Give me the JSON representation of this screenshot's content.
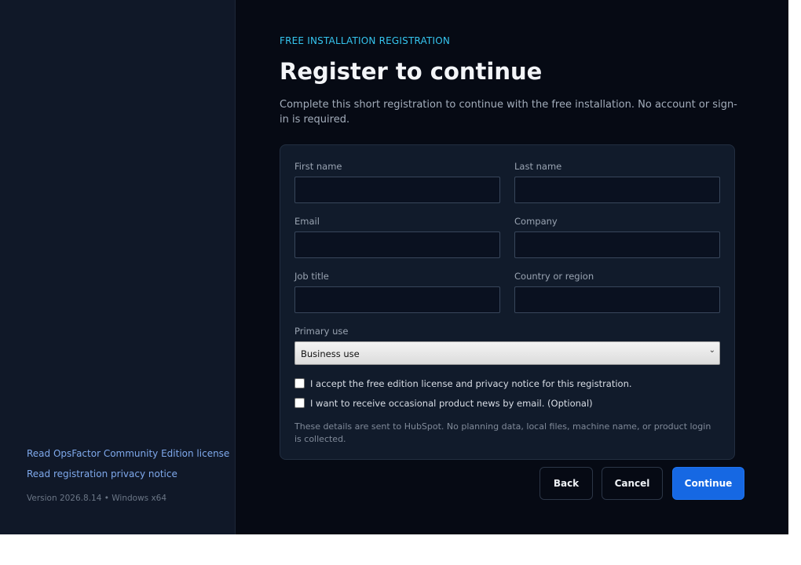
{
  "sidebar": {
    "license_link": "Read OpsFactor Community Edition license",
    "privacy_link": "Read registration privacy notice",
    "version": "Version 2026.8.14 • Windows x64"
  },
  "header": {
    "eyebrow": "FREE INSTALLATION REGISTRATION",
    "title": "Register to continue",
    "subtitle": "Complete this short registration to continue with the free installation. No account or sign-in is required."
  },
  "form": {
    "first_name": {
      "label": "First name",
      "value": ""
    },
    "last_name": {
      "label": "Last name",
      "value": ""
    },
    "email": {
      "label": "Email",
      "value": ""
    },
    "company": {
      "label": "Company",
      "value": ""
    },
    "job_title": {
      "label": "Job title",
      "value": ""
    },
    "country": {
      "label": "Country or region",
      "value": ""
    },
    "primary_use": {
      "label": "Primary use",
      "selected": "Business use"
    },
    "accept_license": {
      "label": "I accept the free edition license and privacy notice for this registration.",
      "checked": false
    },
    "product_news": {
      "label": "I want to receive occasional product news by email. (Optional)",
      "checked": false
    },
    "note": "These details are sent to HubSpot. No planning data, local files, machine name, or product login is collected."
  },
  "buttons": {
    "back": "Back",
    "cancel": "Cancel",
    "continue": "Continue"
  },
  "icons": {
    "dropdown": "chevron-down-icon"
  },
  "colors": {
    "accent": "#1668e3",
    "eyebrow": "#35c5ef",
    "link": "#7fa9ec",
    "background": "#060a14",
    "sidebar": "#101828"
  }
}
